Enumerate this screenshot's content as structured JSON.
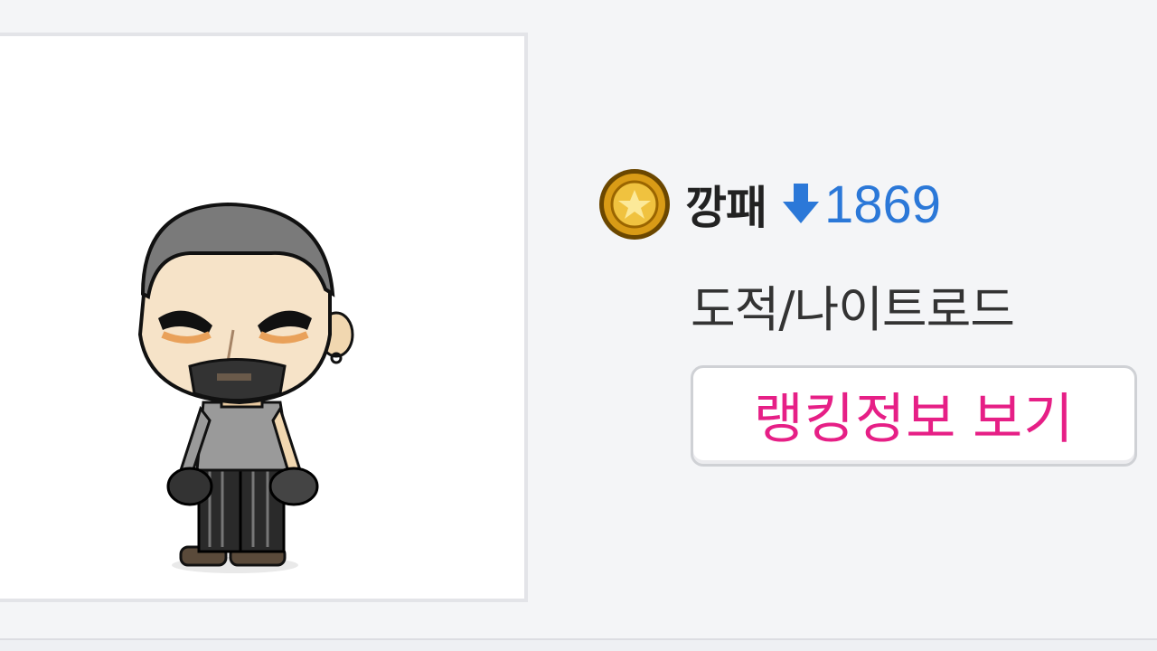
{
  "character": {
    "name": "깡패",
    "rank_change": "1869",
    "rank_direction": "down",
    "job": "도적/나이트로드",
    "medal_icon": "gold-medal-icon",
    "arrow_icon": "arrow-down-icon"
  },
  "actions": {
    "ranking_button_label": "랭킹정보 보기"
  },
  "colors": {
    "rank_change": "#2b78d8",
    "button_text": "#e61f86",
    "background": "#f4f5f7"
  }
}
